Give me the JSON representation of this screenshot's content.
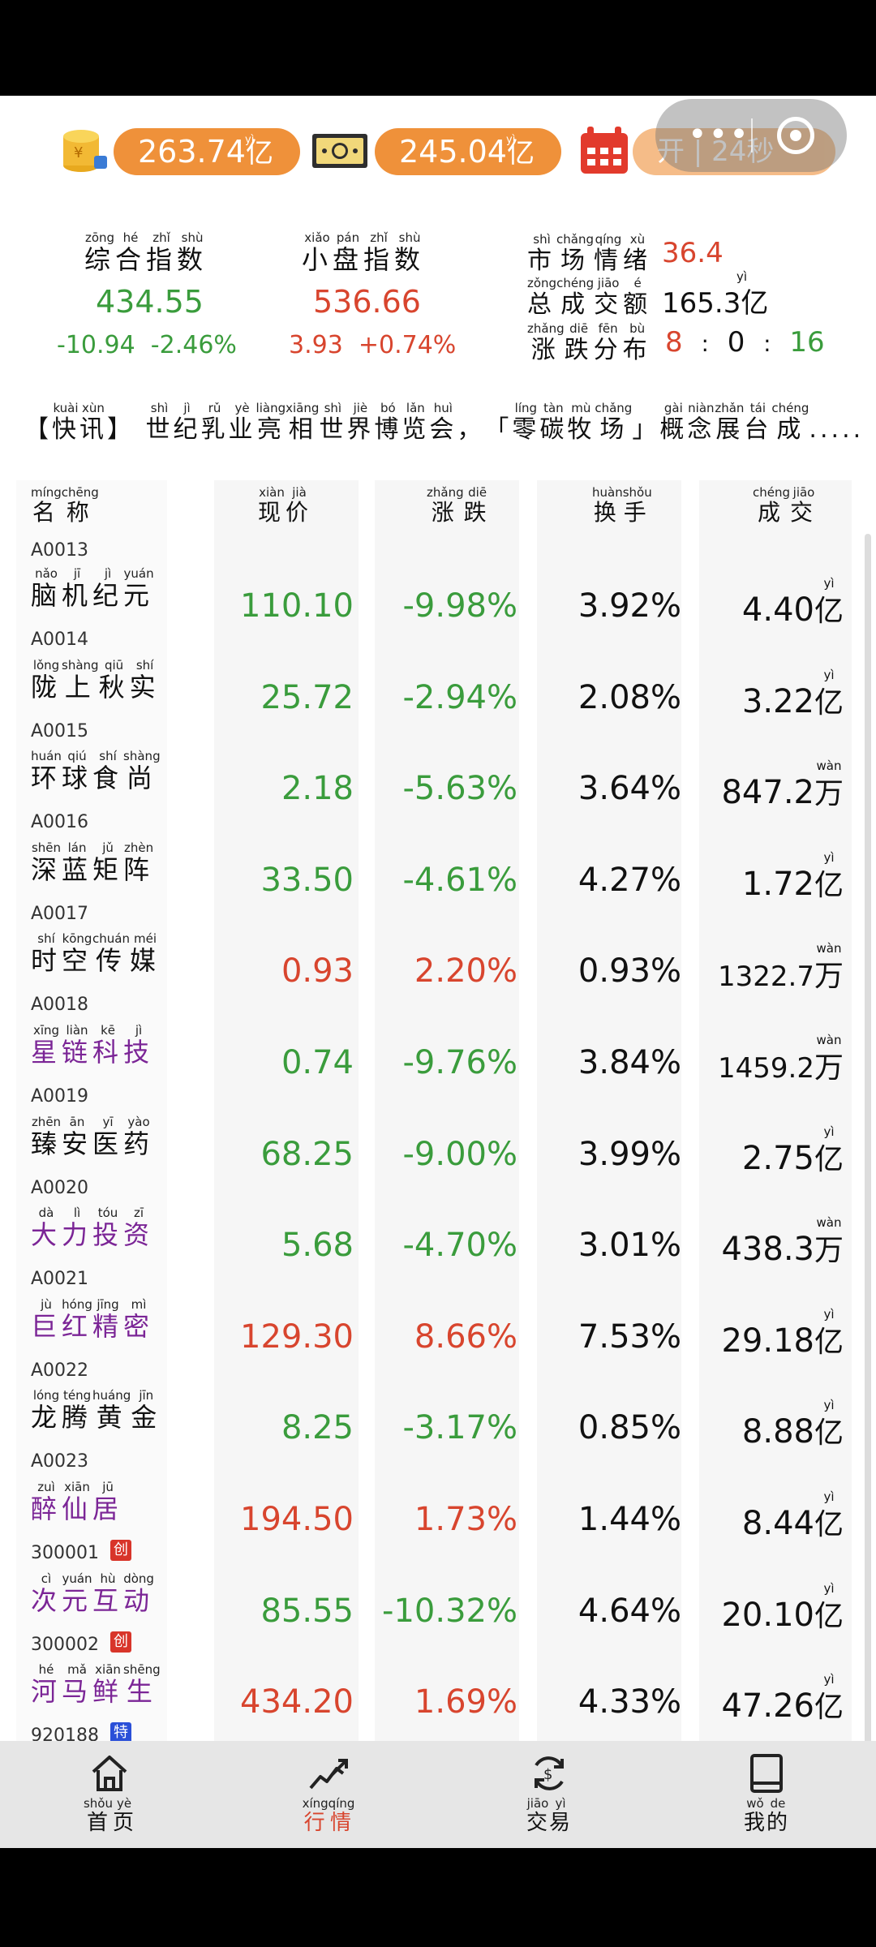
{
  "assets": {
    "coin_value": "263.74",
    "coin_unit": "亿",
    "coin_unit_py": "yì",
    "cash_value": "245.04",
    "cash_unit": "亿",
    "cash_unit_py": "yì",
    "schedule_text": "开 | 24秒"
  },
  "indices": {
    "composite": {
      "title": "综合指数",
      "py": [
        "zōng",
        "hé",
        "zhǐ",
        "shù"
      ],
      "value": "434.55",
      "change": "-10.94",
      "pct": "-2.46%"
    },
    "smallcap": {
      "title": "小盘指数",
      "py": [
        "xiǎo",
        "pán",
        "zhǐ",
        "shù"
      ],
      "value": "536.66",
      "change": "3.93",
      "pct": "+0.74%"
    }
  },
  "market": {
    "sentiment_label": "市场情绪",
    "sentiment_py": [
      "shì",
      "chǎng",
      "qíng",
      "xù"
    ],
    "sentiment_value": "36.4",
    "turnover_label": "总成交额",
    "turnover_py": [
      "zǒng",
      "chéng",
      "jiāo",
      "é"
    ],
    "turnover_value": "165.3亿",
    "turnover_unit_py": "yì",
    "dist_label": "涨跌分布",
    "dist_py": [
      "zhǎng",
      "diē",
      "fēn",
      "bù"
    ],
    "dist_up": "8",
    "dist_flat": "0",
    "dist_down": "16"
  },
  "news": {
    "tag": "【快讯】",
    "tag_py": [
      "kuài",
      "xùn"
    ],
    "text": "世纪乳业亮相世界博览会，「零碳牧场」概念展台成.....",
    "text_py": [
      "shì",
      "jì",
      "rǔ",
      "yè",
      "liàng",
      "xiāng",
      "shì",
      "jiè",
      "bó",
      "lǎn",
      "huì",
      "",
      "",
      "líng",
      "tàn",
      "mù",
      "chǎng",
      "",
      "gài",
      "niàn",
      "zhǎn",
      "tái",
      "chéng"
    ]
  },
  "table": {
    "headers": [
      {
        "label": "名称",
        "py": [
          "míng",
          "chēng"
        ]
      },
      {
        "label": "现价",
        "py": [
          "xiàn",
          "jià"
        ]
      },
      {
        "label": "涨跌",
        "py": [
          "zhǎng",
          "diē"
        ]
      },
      {
        "label": "换手",
        "py": [
          "huàn",
          "shǒu"
        ]
      },
      {
        "label": "成交",
        "py": [
          "chéng",
          "jiāo"
        ]
      }
    ],
    "top_code": "A0013",
    "rows": [
      {
        "name": "脑机纪元",
        "py": [
          "nǎo",
          "jī",
          "jì",
          "yuán"
        ],
        "code": "A0014",
        "price": "110.10",
        "pct": "-9.98%",
        "turnover": "3.92%",
        "vol": "4.40",
        "unit": "亿",
        "unit_py": "yì",
        "color": "green",
        "name_color": "black"
      },
      {
        "name": "陇上秋实",
        "py": [
          "lǒng",
          "shàng",
          "qiū",
          "shí"
        ],
        "code": "A0015",
        "price": "25.72",
        "pct": "-2.94%",
        "turnover": "2.08%",
        "vol": "3.22",
        "unit": "亿",
        "unit_py": "yì",
        "color": "green",
        "name_color": "black"
      },
      {
        "name": "环球食尚",
        "py": [
          "huán",
          "qiú",
          "shí",
          "shàng"
        ],
        "code": "A0016",
        "price": "2.18",
        "pct": "-5.63%",
        "turnover": "3.64%",
        "vol": "847.2",
        "unit": "万",
        "unit_py": "wàn",
        "color": "green",
        "name_color": "black"
      },
      {
        "name": "深蓝矩阵",
        "py": [
          "shēn",
          "lán",
          "jǔ",
          "zhèn"
        ],
        "code": "A0017",
        "price": "33.50",
        "pct": "-4.61%",
        "turnover": "4.27%",
        "vol": "1.72",
        "unit": "亿",
        "unit_py": "yì",
        "color": "green",
        "name_color": "black"
      },
      {
        "name": "时空传媒",
        "py": [
          "shí",
          "kōng",
          "chuán",
          "méi"
        ],
        "code": "A0018",
        "price": "0.93",
        "pct": "2.20%",
        "turnover": "0.93%",
        "vol": "1322.7",
        "unit": "万",
        "unit_py": "wàn",
        "color": "red",
        "name_color": "black"
      },
      {
        "name": "星链科技",
        "py": [
          "xīng",
          "liàn",
          "kē",
          "jì"
        ],
        "code": "A0019",
        "price": "0.74",
        "pct": "-9.76%",
        "turnover": "3.84%",
        "vol": "1459.2",
        "unit": "万",
        "unit_py": "wàn",
        "color": "green",
        "name_color": "purple"
      },
      {
        "name": "臻安医药",
        "py": [
          "zhēn",
          "ān",
          "yī",
          "yào"
        ],
        "code": "A0020",
        "price": "68.25",
        "pct": "-9.00%",
        "turnover": "3.99%",
        "vol": "2.75",
        "unit": "亿",
        "unit_py": "yì",
        "color": "green",
        "name_color": "black"
      },
      {
        "name": "大力投资",
        "py": [
          "dà",
          "lì",
          "tóu",
          "zī"
        ],
        "code": "A0021",
        "price": "5.68",
        "pct": "-4.70%",
        "turnover": "3.01%",
        "vol": "438.3",
        "unit": "万",
        "unit_py": "wàn",
        "color": "green",
        "name_color": "purple"
      },
      {
        "name": "巨红精密",
        "py": [
          "jù",
          "hóng",
          "jīng",
          "mì"
        ],
        "code": "A0022",
        "price": "129.30",
        "pct": "8.66%",
        "turnover": "7.53%",
        "vol": "29.18",
        "unit": "亿",
        "unit_py": "yì",
        "color": "red",
        "name_color": "purple"
      },
      {
        "name": "龙腾黄金",
        "py": [
          "lóng",
          "téng",
          "huáng",
          "jīn"
        ],
        "code": "A0023",
        "price": "8.25",
        "pct": "-3.17%",
        "turnover": "0.85%",
        "vol": "8.88",
        "unit": "亿",
        "unit_py": "yì",
        "color": "green",
        "name_color": "black"
      },
      {
        "name": "醉仙居",
        "py": [
          "zuì",
          "xiān",
          "jū"
        ],
        "code": "300001",
        "badge": "创",
        "badge_color": "#d8352a",
        "price": "194.50",
        "pct": "1.73%",
        "turnover": "1.44%",
        "vol": "8.44",
        "unit": "亿",
        "unit_py": "yì",
        "color": "red",
        "name_color": "purple"
      },
      {
        "name": "次元互动",
        "py": [
          "cì",
          "yuán",
          "hù",
          "dòng"
        ],
        "code": "300002",
        "badge": "创",
        "badge_color": "#d8352a",
        "price": "85.55",
        "pct": "-10.32%",
        "turnover": "4.64%",
        "vol": "20.10",
        "unit": "亿",
        "unit_py": "yì",
        "color": "green",
        "name_color": "purple"
      },
      {
        "name": "河马鲜生",
        "py": [
          "hé",
          "mǎ",
          "xiān",
          "shēng"
        ],
        "code": "920188",
        "badge": "特",
        "badge_color": "#2a4fd8",
        "price": "434.20",
        "pct": "1.69%",
        "turnover": "4.33%",
        "vol": "47.26",
        "unit": "亿",
        "unit_py": "yì",
        "color": "red",
        "name_color": "purple"
      }
    ]
  },
  "tabs": [
    {
      "label": "首页",
      "py": [
        "shǒu",
        "yè"
      ],
      "icon": "home-icon",
      "active": false
    },
    {
      "label": "行情",
      "py": [
        "xíng",
        "qíng"
      ],
      "icon": "trend-icon",
      "active": true
    },
    {
      "label": "交易",
      "py": [
        "jiāo",
        "yì"
      ],
      "icon": "exchange-icon",
      "active": false
    },
    {
      "label": "我的",
      "py": [
        "wǒ",
        "de"
      ],
      "icon": "book-icon",
      "active": false
    }
  ],
  "colors": {
    "green": "#3a9c3c",
    "red": "#d8452e",
    "purple": "#7b2596",
    "orange": "#ef913a"
  }
}
